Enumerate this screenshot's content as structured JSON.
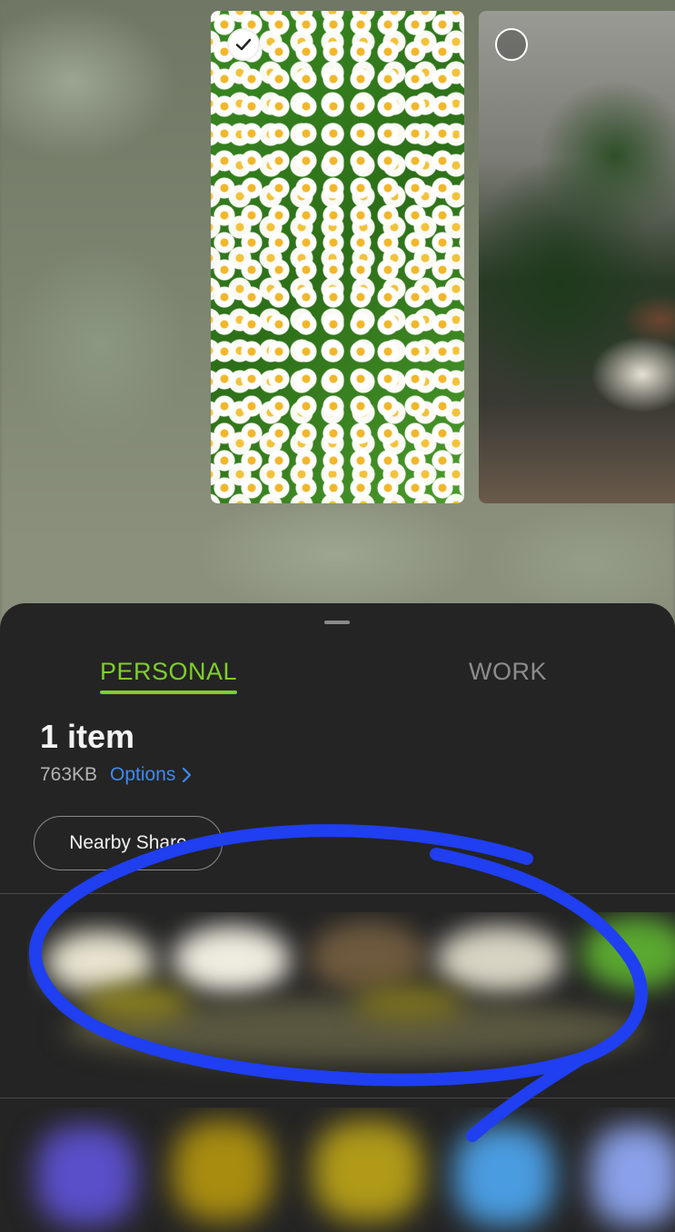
{
  "thumbnails": [
    {
      "name": "daisies photo",
      "selected": true
    },
    {
      "name": "coffee books photo",
      "selected": false
    }
  ],
  "share_sheet": {
    "tabs": [
      {
        "label": "PERSONAL",
        "active": true
      },
      {
        "label": "WORK",
        "active": false
      }
    ],
    "item_count": "1 item",
    "file_size": "763KB",
    "options_label": "Options",
    "nearby_share_label": "Nearby Share"
  },
  "colors": {
    "active_tab": "#7ecf2a",
    "link": "#3d8bf0",
    "sheet_bg": "#242424",
    "annotation": "#1f3ff0"
  },
  "icons": [
    "check-icon",
    "chevron-right-icon"
  ]
}
